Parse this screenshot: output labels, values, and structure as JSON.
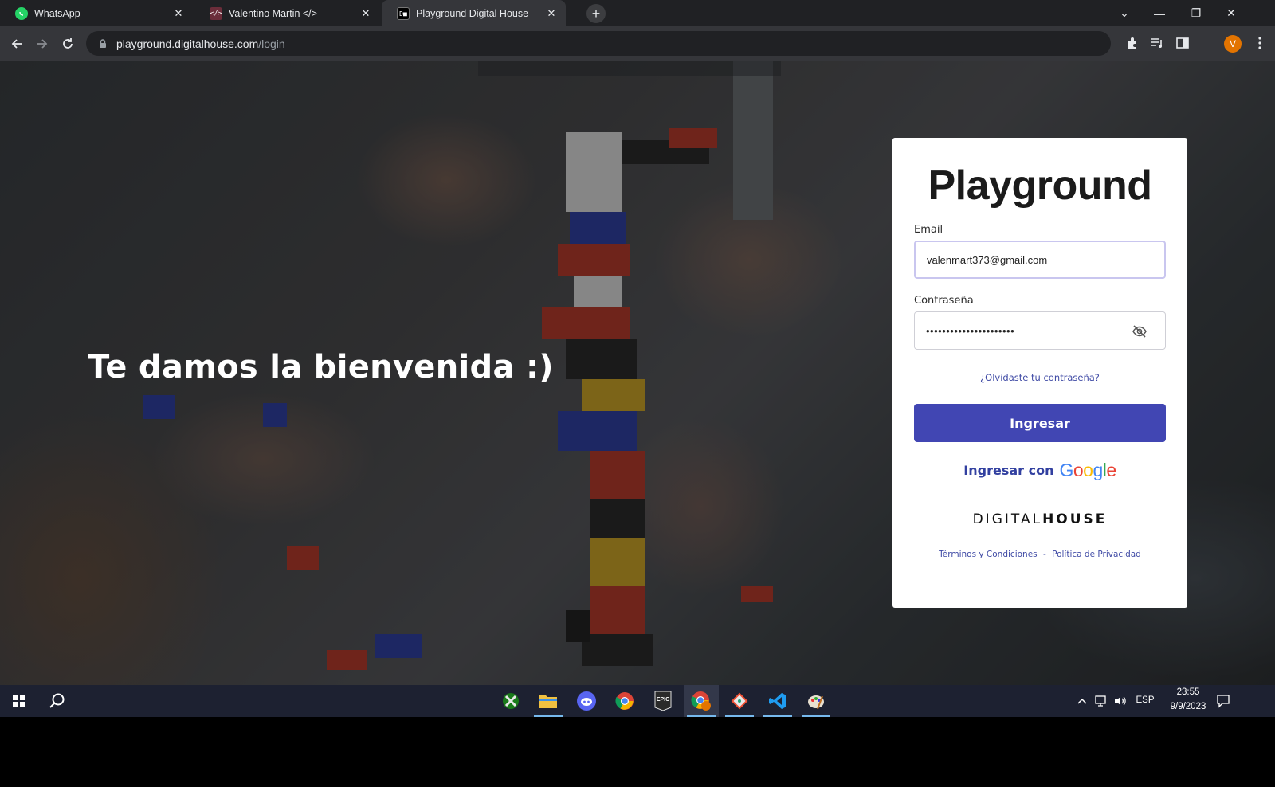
{
  "browser": {
    "tabs": [
      {
        "title": "WhatsApp",
        "favicon": "whatsapp-icon",
        "color": "#25d366"
      },
      {
        "title": "Valentino Martin </>",
        "favicon": "code-icon",
        "color": "#6b2d3a"
      },
      {
        "title": "Playground Digital House",
        "favicon": "dh-icon",
        "color": "#000000",
        "active": true
      }
    ],
    "url_host": "playground.digitalhouse.com",
    "url_path": "/login",
    "profile_initial": "V"
  },
  "page": {
    "welcome": "Te damos la bienvenida :)",
    "brand": "Playground",
    "email_label": "Email",
    "email_value": "valenmart373@gmail.com",
    "password_label": "Contraseña",
    "password_value": "••••••••••••••••••••••",
    "forgot_link": "¿Olvidaste tu contraseña?",
    "submit_label": "Ingresar",
    "google_prefix": "Ingresar con",
    "google_letters": [
      "G",
      "o",
      "o",
      "g",
      "l",
      "e"
    ],
    "google_colors": [
      "#4285f4",
      "#ea4335",
      "#fbbc05",
      "#4285f4",
      "#34a853",
      "#ea4335"
    ],
    "digital": "DIGITAL",
    "house": "HOUSE",
    "terms": "Términos y Condiciones",
    "separator": "-",
    "privacy": "Política de Privacidad",
    "accent_color": "#4146b3"
  },
  "taskbar": {
    "apps": [
      "xbox-icon",
      "file-explorer-icon",
      "discord-icon",
      "chrome-icon",
      "epic-games-icon",
      "chrome-profile-icon",
      "git-icon",
      "vscode-icon",
      "paint-icon"
    ],
    "language": "ESP",
    "time": "23:55",
    "date": "9/9/2023"
  }
}
